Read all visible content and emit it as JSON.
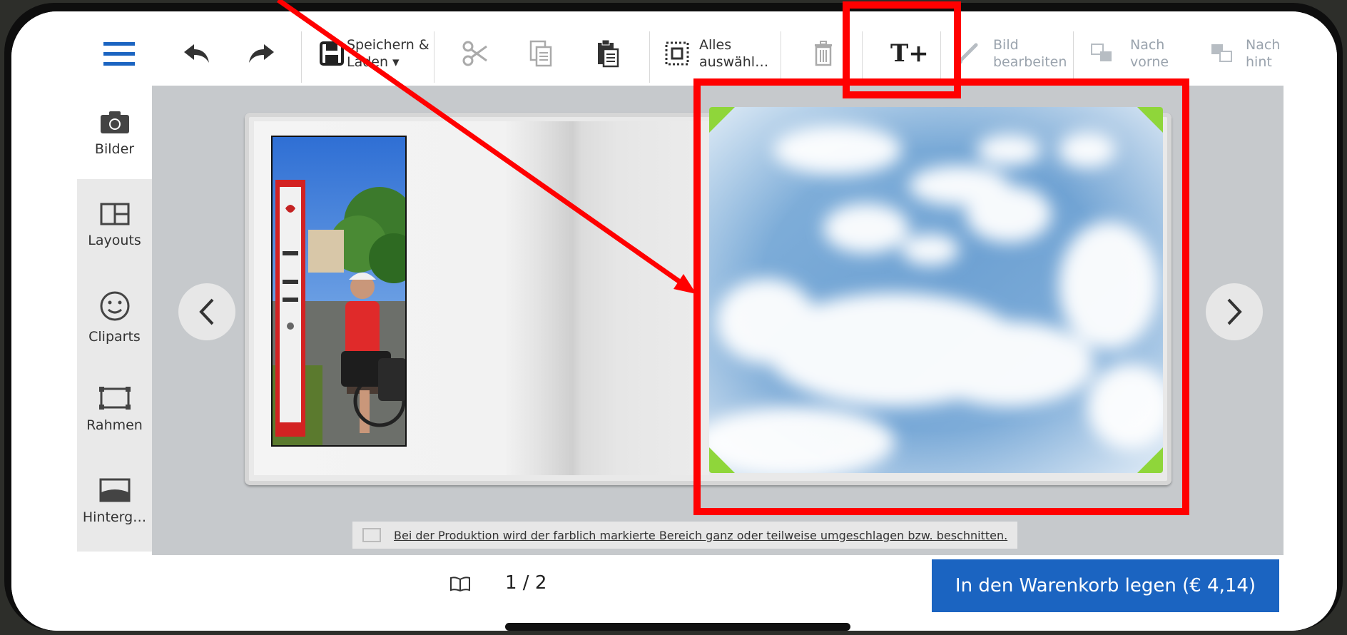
{
  "toolbar": {
    "save_label_line1": "Speichern &",
    "save_label_line2": "Laden ▾",
    "select_all_line1": "Alles",
    "select_all_line2": "auswähl…",
    "edit_image_line1": "Bild",
    "edit_image_line2": "bearbeiten",
    "bring_forward_line1": "Nach",
    "bring_forward_line2": "vorne",
    "send_back_line1": "Nach",
    "send_back_line2": "hint",
    "add_text_glyph": "T+"
  },
  "sidebar": {
    "items": [
      {
        "label": "Bilder",
        "icon": "camera-icon"
      },
      {
        "label": "Layouts",
        "icon": "layout-icon"
      },
      {
        "label": "Cliparts",
        "icon": "smiley-icon"
      },
      {
        "label": "Rahmen",
        "icon": "frame-icon"
      },
      {
        "label": "Hinterg…",
        "icon": "background-icon"
      }
    ]
  },
  "notice": "Bei der Produktion wird der farblich markierte Bereich ganz oder teilweise umgeschlagen bzw. beschnitten.",
  "pager": "1 / 2",
  "cart_button": "In den Warenkorb legen (€ 4,14)",
  "colors": {
    "accent": "#1b64c1",
    "annotation": "#ff0000",
    "corner_marker": "#8fd63a"
  }
}
